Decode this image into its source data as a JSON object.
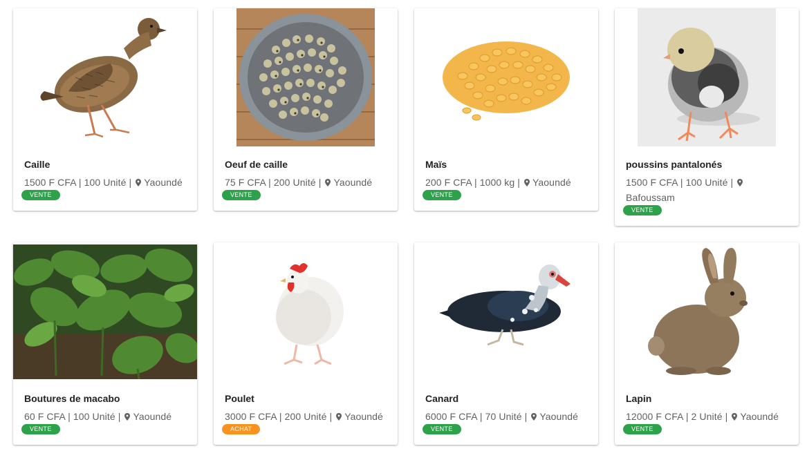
{
  "products": [
    {
      "name": "Caille",
      "price": "1500 F CFA",
      "quantity": "100 Unité",
      "location": "Yaoundé",
      "type": "VENTE",
      "image": "quail-image"
    },
    {
      "name": "Oeuf de caille",
      "price": "75 F CFA",
      "quantity": "200 Unité",
      "location": "Yaoundé",
      "type": "VENTE",
      "image": "quail-eggs-image"
    },
    {
      "name": "Maïs",
      "price": "200 F CFA",
      "quantity": "1000 kg",
      "location": "Yaoundé",
      "type": "VENTE",
      "image": "corn-image"
    },
    {
      "name": "poussins pantalonés",
      "price": "1500 F CFA",
      "quantity": "100 Unité",
      "location": "Bafoussam",
      "type": "VENTE",
      "image": "chick-image"
    },
    {
      "name": "Boutures de macabo",
      "price": "60 F CFA",
      "quantity": "100 Unité",
      "location": "Yaoundé",
      "type": "VENTE",
      "image": "macabo-plants-image"
    },
    {
      "name": "Poulet",
      "price": "3000 F CFA",
      "quantity": "200 Unité",
      "location": "Yaoundé",
      "type": "ACHAT",
      "image": "chicken-image"
    },
    {
      "name": "Canard",
      "price": "6000 F CFA",
      "quantity": "70 Unité",
      "location": "Yaoundé",
      "type": "VENTE",
      "image": "duck-image"
    },
    {
      "name": "Lapin",
      "price": "12000 F CFA",
      "quantity": "2 Unité",
      "location": "Yaoundé",
      "type": "VENTE",
      "image": "rabbit-image"
    }
  ],
  "colors": {
    "vente": "#2ea24a",
    "achat": "#f7931e",
    "title": "#222222",
    "meta": "#616161"
  },
  "icons": {
    "location": "location-pin-icon"
  }
}
